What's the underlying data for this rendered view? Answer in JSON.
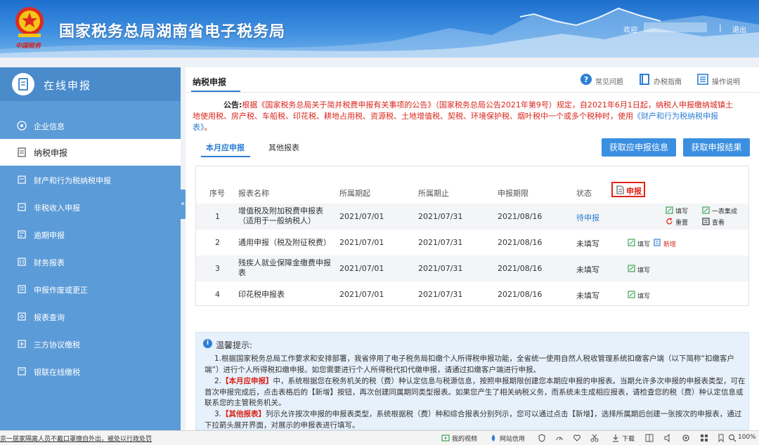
{
  "header": {
    "title": "国家税务总局湖南省电子税务局",
    "slogan": "中国税务",
    "welcome": "欢迎",
    "separator": "|",
    "logout": "退出"
  },
  "sidebar": {
    "title": "在线申报",
    "collapse": "«",
    "items": [
      {
        "label": "企业信息",
        "icon": "building-icon"
      },
      {
        "label": "纳税申报",
        "icon": "form-icon",
        "active": true
      },
      {
        "label": "财产和行为税纳税申报",
        "icon": "property-icon"
      },
      {
        "label": "非税收入申报",
        "icon": "income-icon"
      },
      {
        "label": "逾期申报",
        "icon": "overdue-icon"
      },
      {
        "label": "财务报表",
        "icon": "report-icon"
      },
      {
        "label": "申报作废或更正",
        "icon": "correct-icon"
      },
      {
        "label": "报表查询",
        "icon": "query-icon"
      },
      {
        "label": "三方协议缴税",
        "icon": "agreement-icon"
      },
      {
        "label": "银联在线缴税",
        "icon": "unionpay-icon"
      }
    ]
  },
  "main": {
    "tab": "纳税申报",
    "links": {
      "faq": "常见问题",
      "guide": "办税指南",
      "manual": "操作说明"
    },
    "notice": {
      "label": "公告:",
      "text": "根据《国家税务总局关于简并税费申报有关事项的公告》（国家税务总局公告2021年第9号）规定，自2021年6月1日起，纳税人申报缴纳城镇土地使用税、房产税、车船税、印花税、耕地占用税、资源税、土地增值税、契税、环境保护税、烟叶税中一个或多个税种时，使用",
      "link": "《财产和行为税纳税申报表》",
      "end": "。"
    },
    "subtabs": [
      "本月应申报",
      "其他报表"
    ],
    "buttons": {
      "get_info": "获取应申报信息",
      "get_result": "获取申报结果"
    },
    "table": {
      "headers": [
        "序号",
        "报表名称",
        "所属期起",
        "所属期止",
        "申报期限",
        "状态",
        "操作"
      ],
      "rows": [
        {
          "no": "1",
          "name": "增值税及附加税费申报表（适用于一般纳税人）",
          "start": "2021/07/01",
          "end": "2021/07/31",
          "deadline": "2021/08/16",
          "status": "待申报"
        },
        {
          "no": "2",
          "name": "通用申报（税及附征税费）",
          "start": "2021/07/01",
          "end": "2021/07/31",
          "deadline": "2021/08/16",
          "status": "未填写"
        },
        {
          "no": "3",
          "name": "残疾人就业保障金缴费申报表",
          "start": "2021/07/01",
          "end": "2021/07/31",
          "deadline": "2021/08/16",
          "status": "未填写"
        },
        {
          "no": "4",
          "name": "印花税申报表",
          "start": "2021/07/01",
          "end": "2021/07/31",
          "deadline": "2021/08/16",
          "status": "未填写"
        }
      ],
      "actions": {
        "apply": "申报",
        "fill": "填写",
        "reset": "重置",
        "one_form": "一表集成",
        "view": "查看",
        "add": "新增"
      }
    },
    "tips": {
      "title": "温馨提示:",
      "p1": "1.根据国家税务总局工作要求和安排部署，我省停用了电子税务局扣缴个人所得税申报功能，全省统一使用自然人税收管理系统扣缴客户端（以下简称“扣缴客户端”）进行个人所得税扣缴申报。如您需要进行个人所得税代扣代缴申报，请通过扣缴客户端进行申报。",
      "p2_prefix": "2.",
      "p2_hl": "【本月应申报】",
      "p2": "中，系统根据您在税务机关的税（费）种认定信息与税源信息，按照申报期限创建您本期应申报的申报表。当期允许多次申报的申报表类型，可在首次申报完成后，点击表格后的【新增】按钮，再次创建同属期同类型报表。如果您产生了相关纳税义务，而系统未生成相应报表，请检查您的税（费）种认定信息或联系您的主管税务机关。",
      "p3_prefix": "3.",
      "p3_hl": "【其他报表】",
      "p3": "列示允许按次申报的申报表类型，系统根据税（费）种和综合报表分别列示，您可以通过点击【新增】，选择所属期后创建一张按次的申报表，通过下拉箭头展开界面，对展示的申报表进行填写。"
    }
  },
  "statusbar": {
    "message": "京一居家隔离人员不戴口罩擅自外出，被处以行政处罚",
    "video": "我的视频",
    "network": "网站信用",
    "download": "下载",
    "zoom": "100%"
  },
  "colors": {
    "primary": "#2e7fd5",
    "sidebar": "#5b9bd8",
    "alert": "#d9251c"
  }
}
